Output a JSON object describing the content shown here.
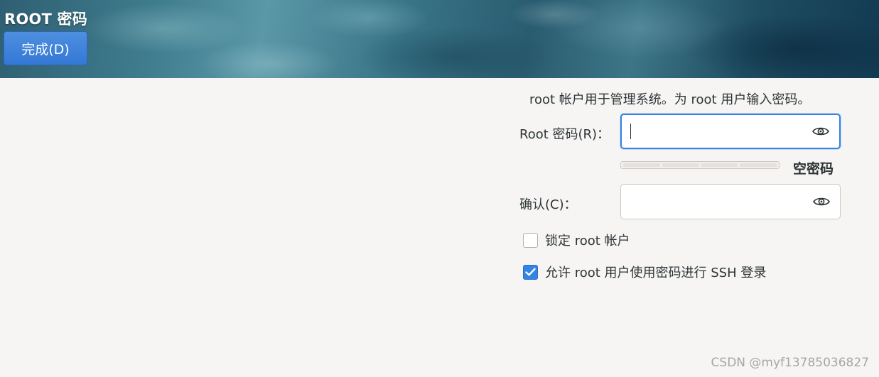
{
  "header": {
    "title": "ROOT 密码",
    "done_label": "完成(D)"
  },
  "main": {
    "description": "root 帐户用于管理系统。为 root 用户输入密码。",
    "password_label": "Root 密码(R)：",
    "password_value": "",
    "confirm_label": "确认(C)：",
    "confirm_value": "",
    "strength_label": "空密码",
    "strength_fraction": 0,
    "lock_root": {
      "label": "锁定 root 帐户",
      "checked": false
    },
    "allow_ssh": {
      "label": "允许 root 用户使用密码进行 SSH 登录",
      "checked": true
    }
  },
  "icons": {
    "reveal_password": "eye-icon",
    "checkmark": "check-icon"
  },
  "colors": {
    "accent": "#3584e4",
    "done_button": "#3478d6",
    "background": "#f6f5f4"
  },
  "watermark": "CSDN @myf13785036827"
}
